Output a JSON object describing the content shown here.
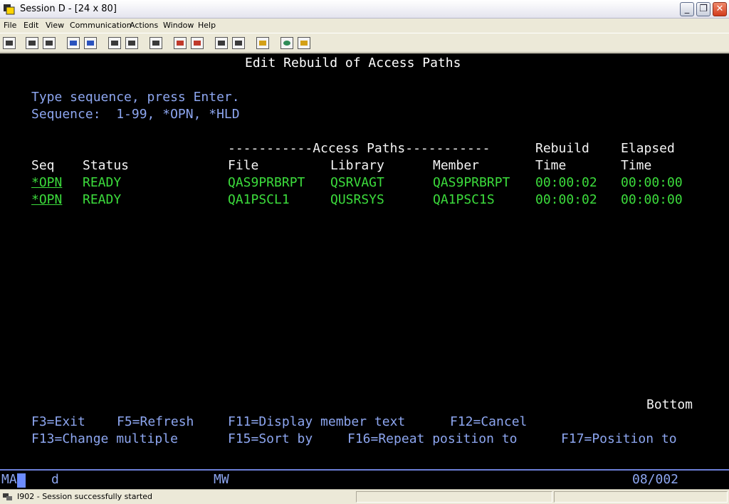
{
  "window": {
    "title": "Session D - [24 x 80]",
    "min_symbol": "_",
    "max_symbol": "❐",
    "close_symbol": "✕"
  },
  "menu": [
    "File",
    "Edit",
    "View",
    "Communication",
    "Actions",
    "Window",
    "Help"
  ],
  "toolbar_icons": [
    "print-screen-icon",
    "copy-icon",
    "paste-icon",
    "send-file-icon",
    "receive-file-icon",
    "display-keypad-icon",
    "keypad-icon",
    "macro-icon",
    "record-macro-icon",
    "play-macro-icon",
    "stop-macro-icon",
    "pause-macro-icon",
    "clipboard-icon",
    "globe-icon",
    "help-icon"
  ],
  "screen": {
    "title": "Edit Rebuild of Access Paths",
    "instruction": "Type sequence, press Enter.",
    "sequence_hint": "Sequence:  1-99, *OPN, *HLD",
    "group_header": "-----------Access Paths-----------",
    "rebuild_header": "Rebuild",
    "elapsed_header": "Elapsed",
    "columns": {
      "seq": "Seq",
      "status": "Status",
      "file": "File",
      "library": "Library",
      "member": "Member",
      "rebuild_time": "Time",
      "elapsed_time": "Time"
    },
    "rows": [
      {
        "seq": "*OPN",
        "status": "READY",
        "file": "QAS9PRBRPT",
        "library": "QSRVAGT",
        "member": "QAS9PRBRPT",
        "rebuild": "00:00:02",
        "elapsed": "00:00:00"
      },
      {
        "seq": "*OPN",
        "status": "READY",
        "file": "QA1PSCL1",
        "library": "QUSRSYS",
        "member": "QA1PSC1S",
        "rebuild": "00:00:02",
        "elapsed": "00:00:00"
      }
    ],
    "bottom_indicator": "Bottom",
    "fkeys_line1": {
      "f3": "F3=Exit",
      "f5": "F5=Refresh",
      "f11": "F11=Display member text",
      "f12": "F12=Cancel"
    },
    "fkeys_line2": {
      "f13": "F13=Change multiple",
      "f15": "F15=Sort by",
      "f16": "F16=Repeat position to",
      "f17": "F17=Position to"
    }
  },
  "oia": {
    "session_indicator": "MA",
    "session_letter": "d",
    "mode": "MW",
    "cursor_position": "08/002"
  },
  "status_bar": {
    "message": "I902 - Session successfully started"
  }
}
